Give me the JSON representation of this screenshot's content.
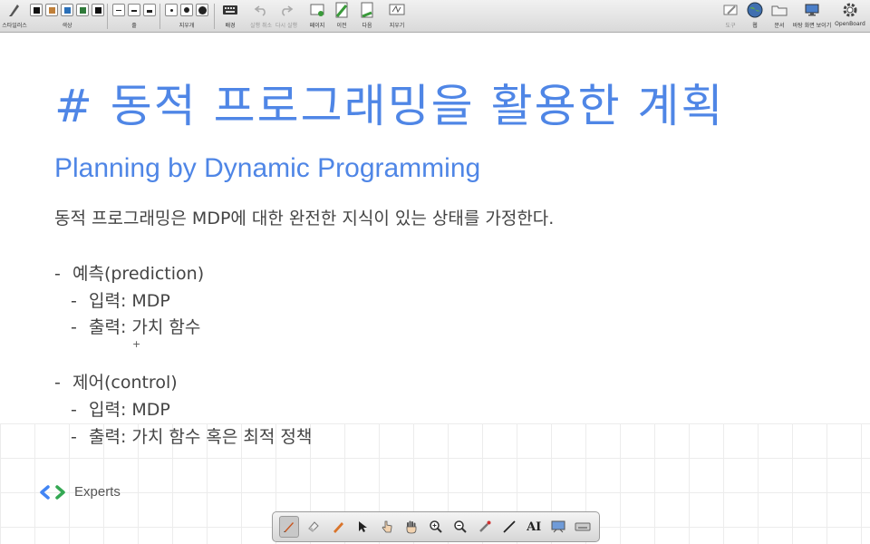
{
  "toolbar": {
    "stylus_label": "스타일러스",
    "color_label": "색상",
    "line_label": "줄",
    "eraser_label": "지우개",
    "background_label": "배경",
    "undo_label": "실행 취소",
    "redo_label": "다시 실행",
    "page_label": "페이지",
    "prev_label": "이전",
    "next_label": "다음",
    "erase_label": "지우기",
    "tools_label": "도구",
    "web_label": "웹",
    "documents_label": "문서",
    "show_desktop_label": "바탕 화면 보이기",
    "openboard_label": "OpenBoard",
    "colors": [
      "#111111",
      "#c0803a",
      "#2a6fb8",
      "#2f7a3a",
      "#111111"
    ]
  },
  "slide": {
    "title": "# 동적 프로그래밍을 활용한 계획",
    "subtitle": "Planning by Dynamic Programming",
    "intro": "동적 프로그래밍은 MDP에 대한 완전한 지식이 있는 상태를 가정한다.",
    "dash": "-",
    "prediction": {
      "heading": "예측(prediction)",
      "input": "입력: MDP",
      "output": "출력: 가치 함수"
    },
    "control": {
      "heading": "제어(control)",
      "input": "입력: MDP",
      "output": "출력: 가치 함수 혹은 최적 정책"
    },
    "plus_mark": "+",
    "experts_label": "Experts",
    "accent_color": "#4f86e6"
  },
  "drawbar": {
    "text_tool_label": "AI"
  }
}
